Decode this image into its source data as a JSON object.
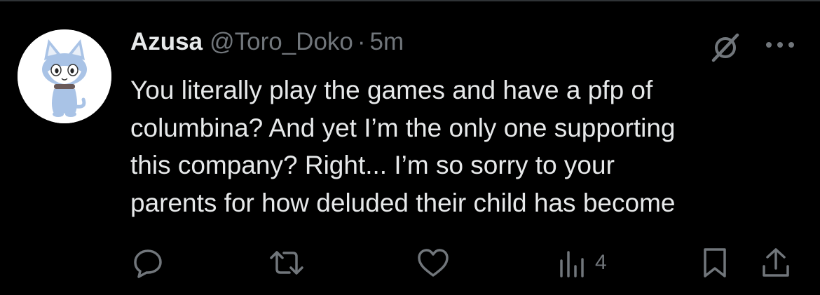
{
  "tweet": {
    "author": {
      "display_name": "Azusa",
      "handle": "@Toro_Doko",
      "avatar_icon": "cat-character-avatar"
    },
    "separator": "·",
    "timestamp": "5m",
    "text": "You literally play the games and have a pfp of\ncolumbina? And yet I’m the only one supporting\nthis company? Right... I’m so sorry to your\nparents for how deluded their child has become",
    "header_icons": [
      "grok-icon",
      "more-icon"
    ],
    "actions": {
      "reply_icon": "reply-icon",
      "retweet_icon": "retweet-icon",
      "like_icon": "heart-icon",
      "views_icon": "views-icon",
      "views_count": "4",
      "bookmark_icon": "bookmark-icon",
      "share_icon": "share-icon"
    }
  },
  "colors": {
    "background": "#000000",
    "primary_text": "#e7e9ea",
    "secondary_text": "#71767b",
    "divider": "#2f3336"
  }
}
